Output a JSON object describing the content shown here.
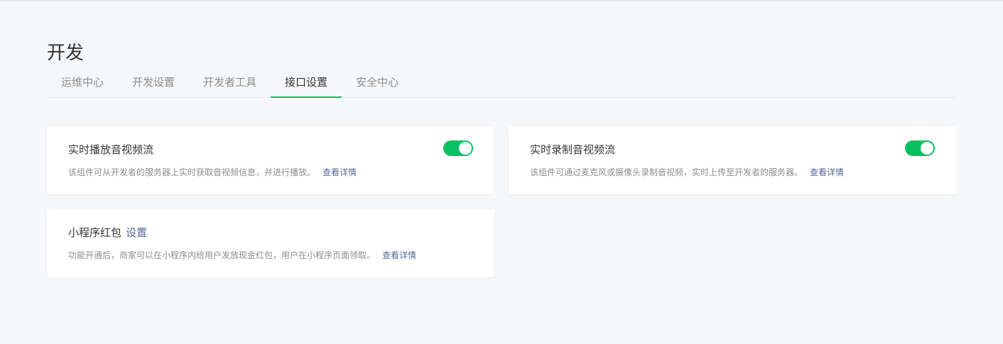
{
  "page": {
    "title": "开发"
  },
  "tabs": [
    {
      "label": "运维中心",
      "active": false
    },
    {
      "label": "开发设置",
      "active": false
    },
    {
      "label": "开发者工具",
      "active": false
    },
    {
      "label": "接口设置",
      "active": true
    },
    {
      "label": "安全中心",
      "active": false
    }
  ],
  "cards": {
    "live_play": {
      "title": "实时播放音视频流",
      "description": "该组件可从开发者的服务器上实时获取音视频信息，并进行播放。",
      "detail_link": "查看详情",
      "enabled": true
    },
    "live_push": {
      "title": "实时录制音视频流",
      "description": "该组件可通过麦克风或摄像头录制音视频，实时上传至开发者的服务器。",
      "detail_link": "查看详情",
      "enabled": true
    },
    "red_packet": {
      "title": "小程序红包",
      "settings_link": "设置",
      "description": "功能开通后，商家可以在小程序内给用户发放现金红包，用户在小程序页面领取。",
      "detail_link": "查看详情"
    }
  },
  "colors": {
    "accent": "#07c160",
    "link": "#576b95",
    "background": "#f6f7f9",
    "muted_text": "#8d8d8d"
  }
}
